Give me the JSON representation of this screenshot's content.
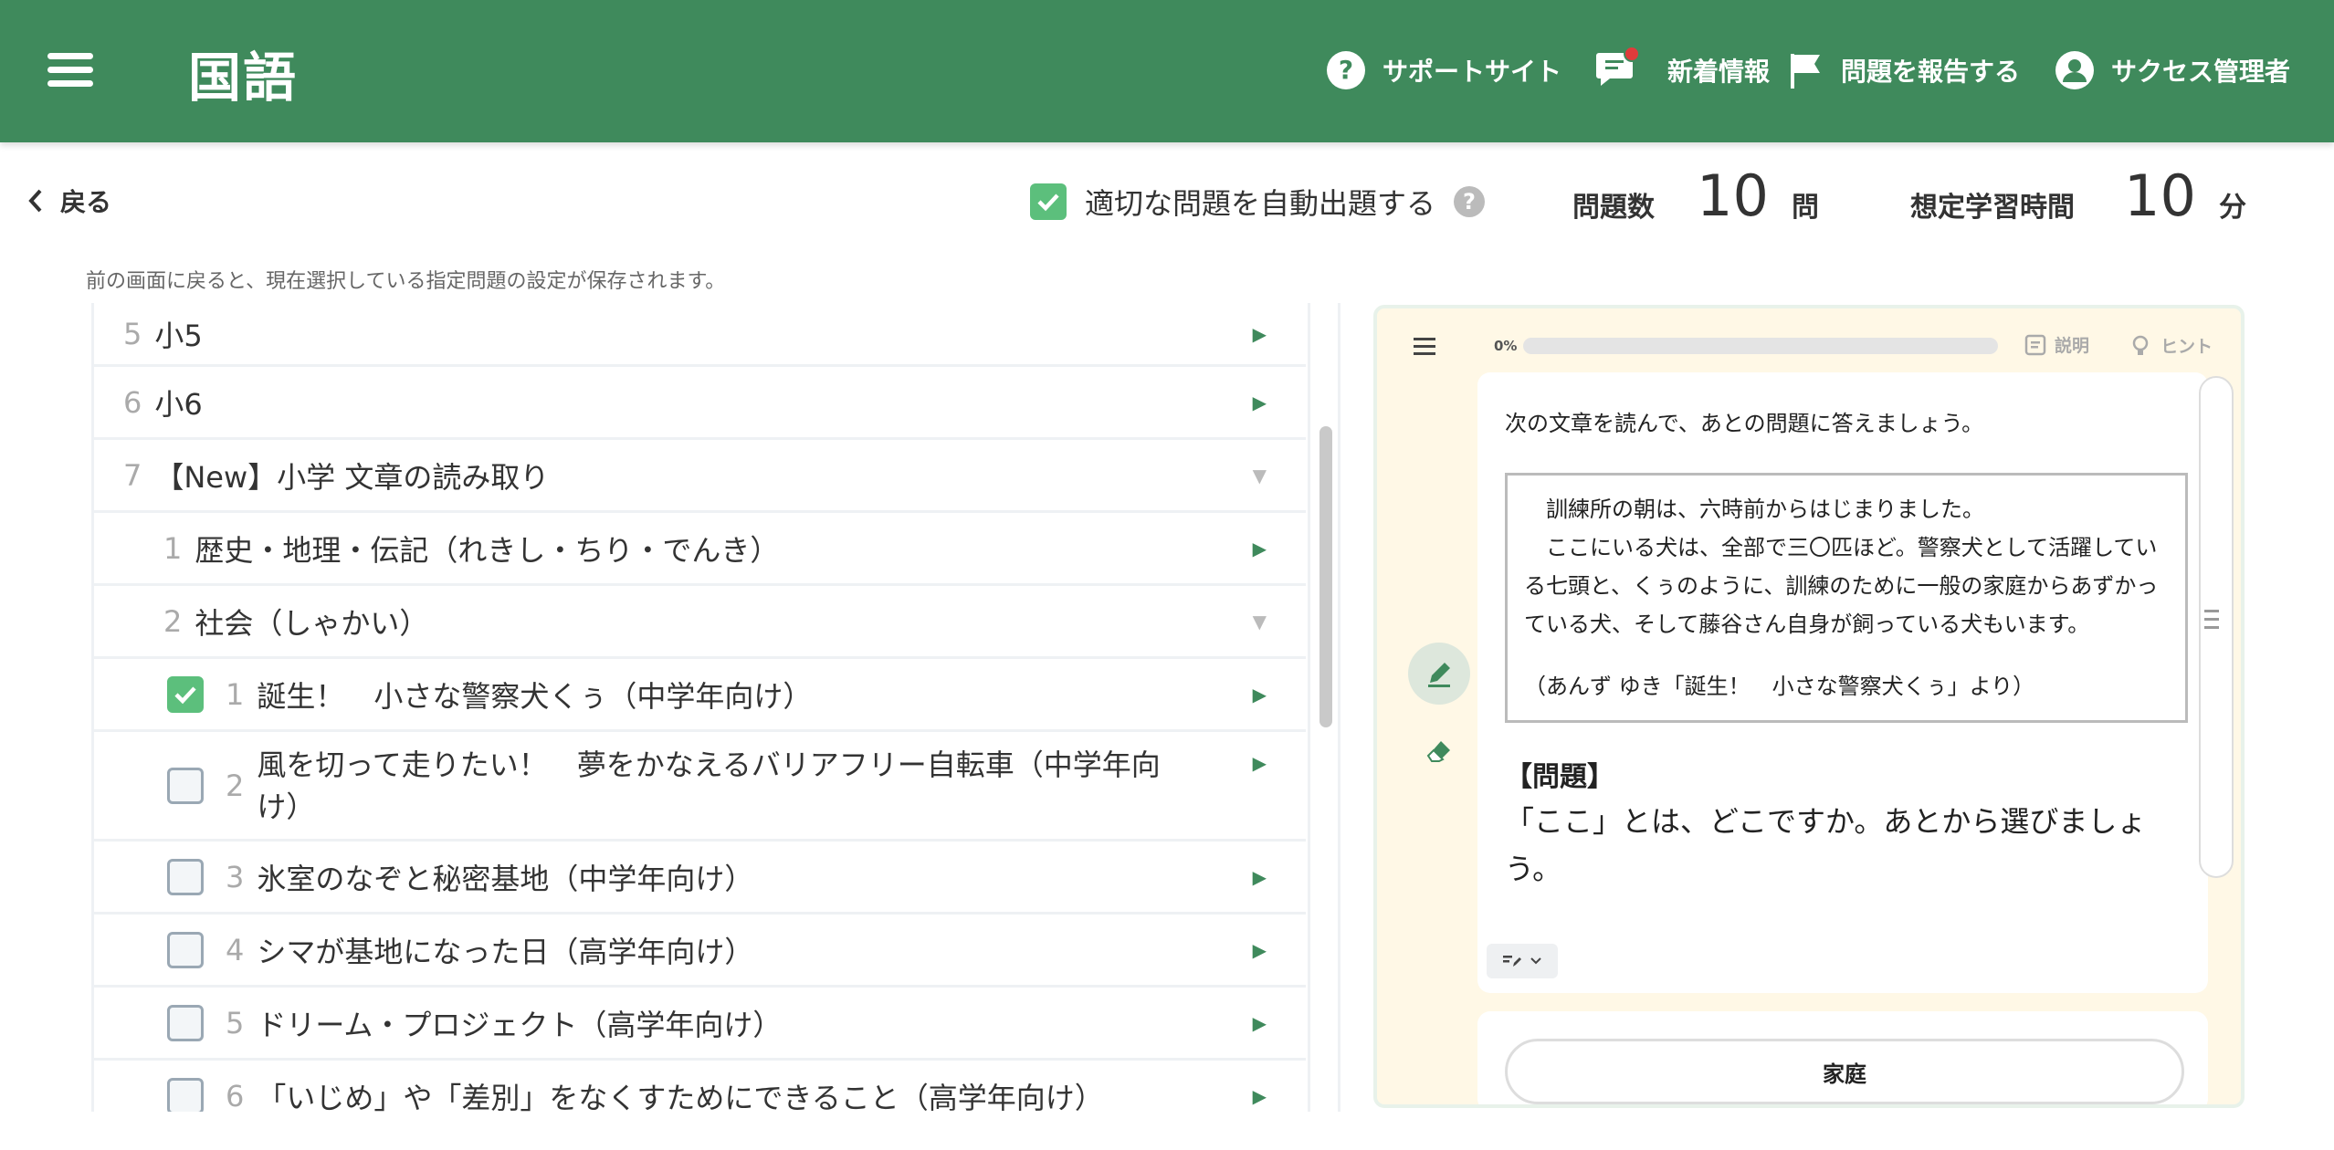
{
  "header": {
    "title": "国語",
    "support": "サポートサイト",
    "news": "新着情報",
    "report": "問題を報告する",
    "user": "サクセス管理者"
  },
  "toolbar": {
    "back": "戻る",
    "auto_label": "適切な問題を自動出題する",
    "count_label": "問題数",
    "count_value": "10",
    "count_unit": "問",
    "time_label": "想定学習時間",
    "time_value": "10",
    "time_unit": "分",
    "note": "前の画面に戻ると、現在選択している指定問題の設定が保存されます。"
  },
  "list": {
    "items": [
      {
        "num": "5",
        "text": "小5",
        "expanded": false
      },
      {
        "num": "6",
        "text": "小6",
        "expanded": false
      },
      {
        "num": "7",
        "text": "【New】小学 文章の読み取り",
        "expanded": true
      },
      {
        "num": "1",
        "text": "歴史・地理・伝記（れきし・ちり・でんき）",
        "expanded": false
      },
      {
        "num": "2",
        "text": "社会（しゃかい）",
        "expanded": true
      },
      {
        "num": "1",
        "text": "誕生！　小さな警察犬くぅ（中学年向け）",
        "checked": true
      },
      {
        "num": "2",
        "text": "風を切って走りたい！　夢をかなえるバリアフリー自転車（中学年向",
        "text2": "け）",
        "checked": false
      },
      {
        "num": "3",
        "text": "氷室のなぞと秘密基地（中学年向け）",
        "checked": false
      },
      {
        "num": "4",
        "text": "シマが基地になった日（高学年向け）",
        "checked": false
      },
      {
        "num": "5",
        "text": "ドリーム・プロジェクト（高学年向け）",
        "checked": false
      },
      {
        "num": "6",
        "text": "「いじめ」や「差別」をなくすためにできること（高学年向け）",
        "checked": false
      }
    ]
  },
  "preview": {
    "progress": "0%",
    "progress_value": 0,
    "explain": "説明",
    "hint": "ヒント",
    "instruction": "次の文章を読んで、あとの問題に答えましょう。",
    "passage": [
      "訓練所の朝は、六時前からはじまりました。",
      "ここにいる犬は、全部で三〇匹ほど。警察犬として活躍している七頭と、くぅのように、訓練のために一般の家庭からあずかっている犬、そして藤谷さん自身が飼っている犬もいます。"
    ],
    "source": "（あんず ゆき「誕生！　小さな警察犬くぅ」より）",
    "question_title": "【問題】",
    "question": "「ここ」とは、どこですか。あとから選びましょう。",
    "answer": "家庭"
  },
  "colors": {
    "brand": "#3f8a5c",
    "check": "#5cbf7c",
    "preview_bg": "#fff8e6",
    "badge": "#e03b3b"
  }
}
